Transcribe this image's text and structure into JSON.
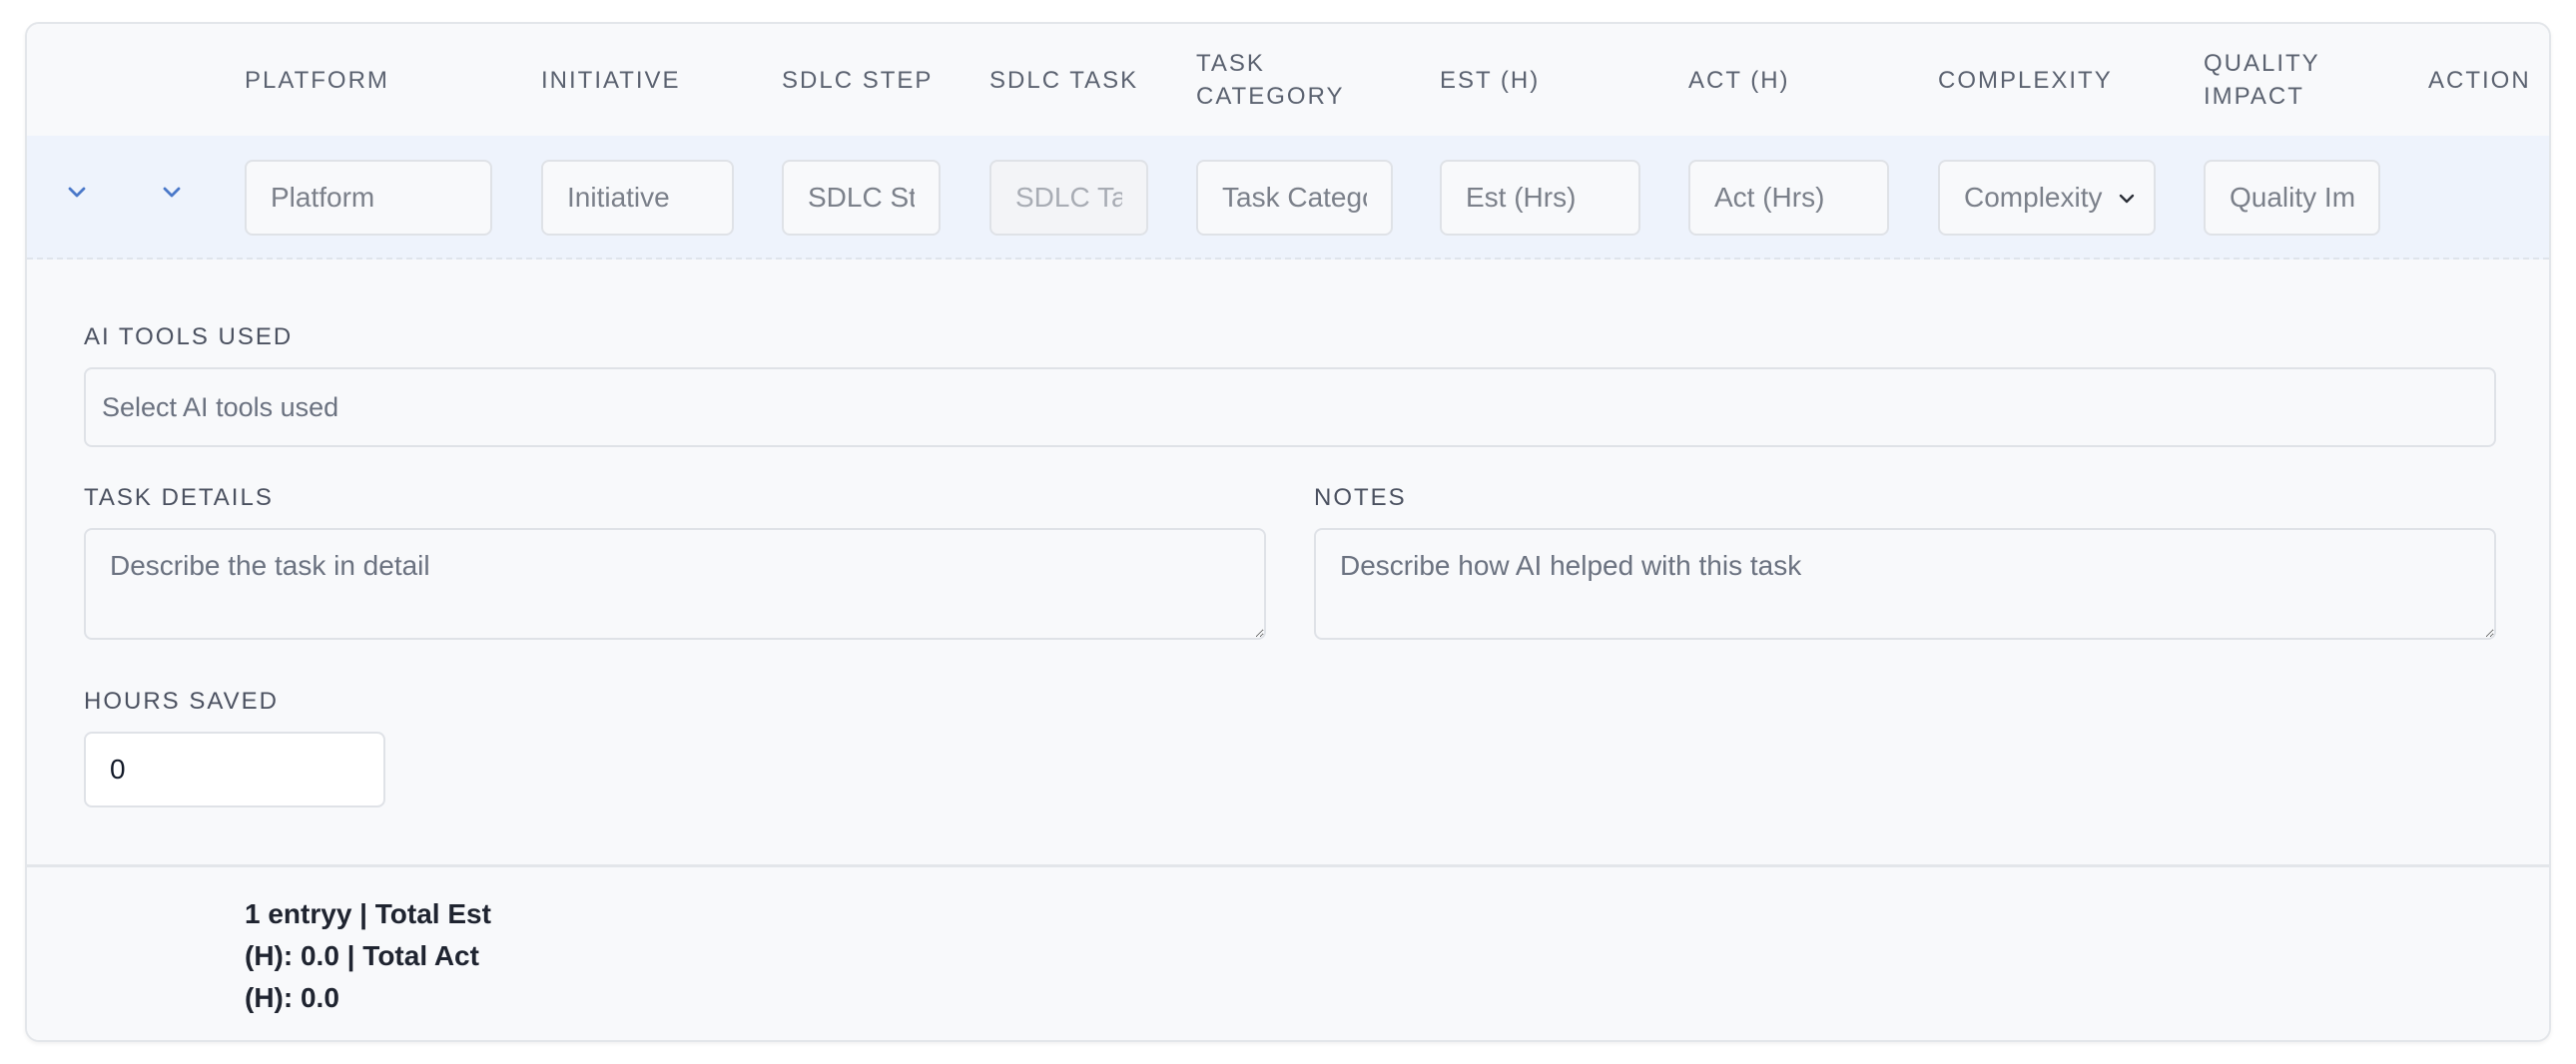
{
  "table": {
    "headers": {
      "platform": "PLATFORM",
      "initiative": "INITIATIVE",
      "sdlc_step": "SDLC STEP",
      "sdlc_task": "SDLC TASK",
      "task_category": "TASK CATEGORY",
      "est_h": "EST (H)",
      "act_h": "ACT (H)",
      "complexity": "COMPLEXITY",
      "quality_impact": "QUALITY IMPACT",
      "action": "ACTION"
    },
    "row": {
      "platform": {
        "value": "",
        "placeholder": "Platform"
      },
      "initiative": {
        "value": "",
        "placeholder": "Initiative"
      },
      "sdlc_step": {
        "value": "",
        "placeholder": "SDLC Step"
      },
      "sdlc_task": {
        "value": "",
        "placeholder": "SDLC Task"
      },
      "task_category": {
        "value": "",
        "placeholder": "Task Category"
      },
      "est_hrs": {
        "value": "",
        "placeholder": "Est (Hrs)"
      },
      "act_hrs": {
        "value": "",
        "placeholder": "Act (Hrs)"
      },
      "complexity": {
        "selected": "Complexity"
      },
      "quality_impact": {
        "value": "",
        "placeholder": "Quality Impact"
      }
    }
  },
  "details": {
    "ai_tools": {
      "label": "AI TOOLS USED",
      "placeholder": "Select AI tools used"
    },
    "task_details": {
      "label": "TASK DETAILS",
      "placeholder": "Describe the task in detail"
    },
    "notes": {
      "label": "NOTES",
      "placeholder": "Describe how AI helped with this task"
    },
    "hours_saved": {
      "label": "HOURS SAVED",
      "value": "0"
    }
  },
  "footer": {
    "summary": "1 entryy | Total Est (H): 0.0 | Total Act (H): 0.0"
  },
  "colors": {
    "accent": "#4a78c9",
    "row_highlight": "#eef3fc",
    "card_bg": "#f8f9fb",
    "border": "#dfe2e7",
    "header_text": "#5b6270"
  },
  "icons": {
    "expand_toggle": "chevron-down-icon",
    "select_toggle": "chevron-down-icon",
    "select_arrow": "chevron-down-icon"
  }
}
